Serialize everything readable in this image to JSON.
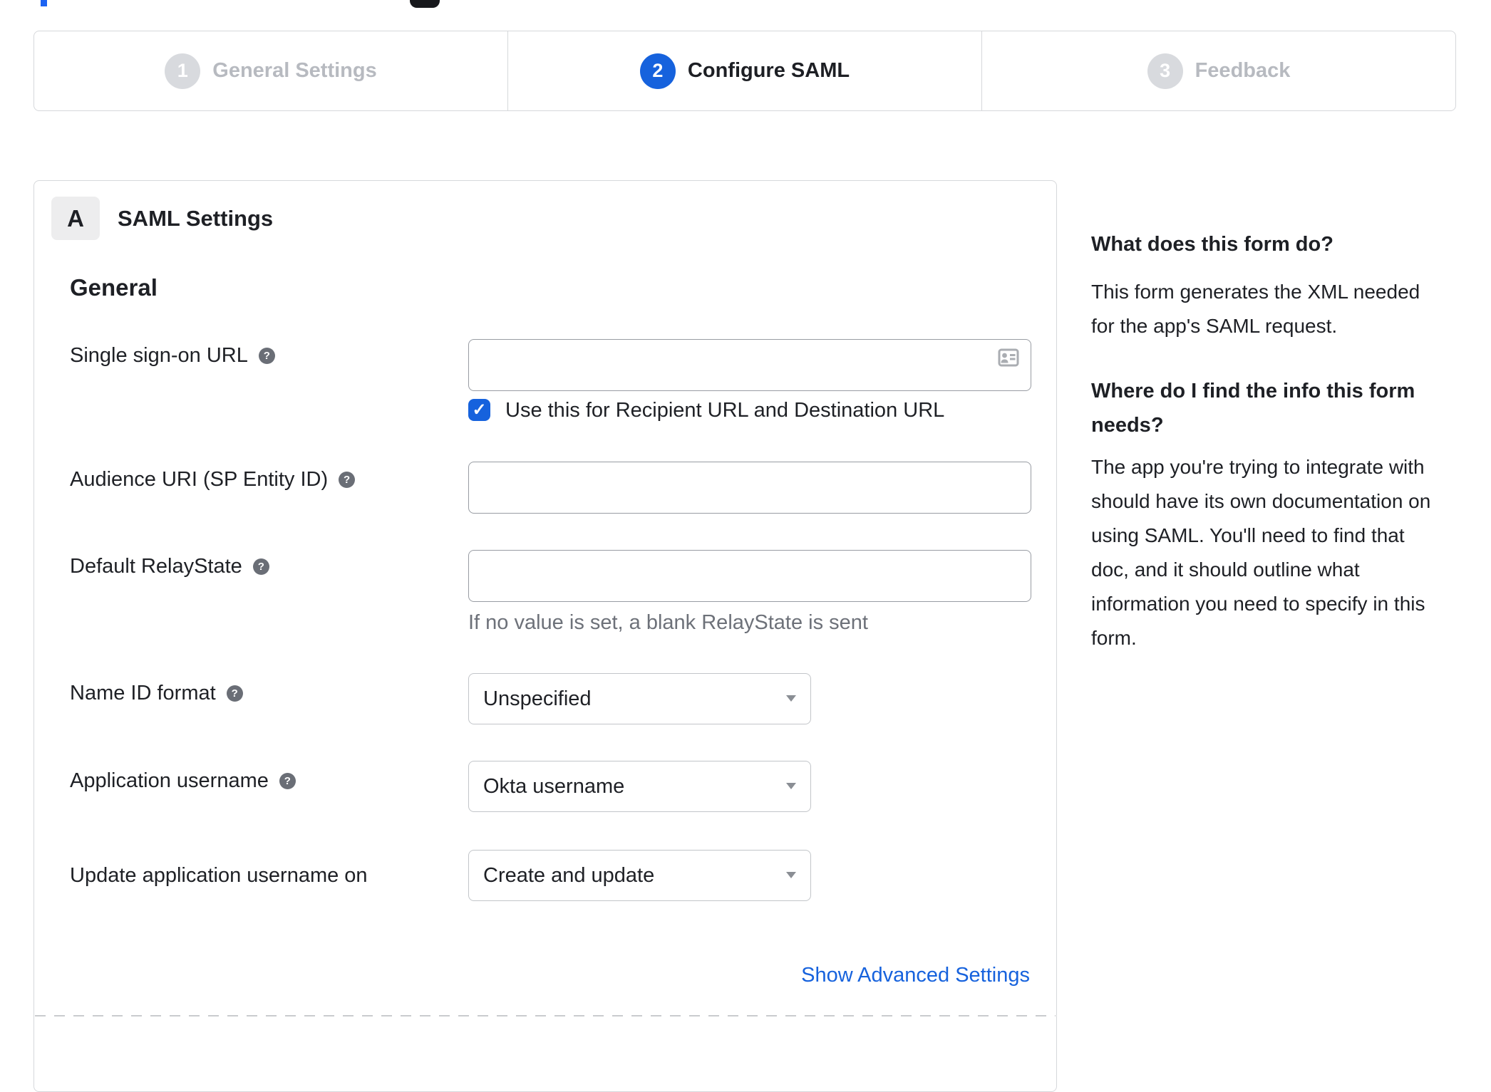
{
  "glyphs": {
    "help_icon": "?",
    "check_icon": "✓"
  },
  "stepper": {
    "steps": [
      {
        "number": "1",
        "label": "General Settings",
        "state": "inactive"
      },
      {
        "number": "2",
        "label": "Configure SAML",
        "state": "active"
      },
      {
        "number": "3",
        "label": "Feedback",
        "state": "inactive"
      }
    ]
  },
  "form": {
    "section_badge": "A",
    "section_title": "SAML Settings",
    "group_heading": "General",
    "sso_url": {
      "label": "Single sign-on URL",
      "value": "",
      "checkbox_label": "Use this for Recipient URL and Destination URL",
      "checkbox_checked": true
    },
    "audience_uri": {
      "label": "Audience URI (SP Entity ID)",
      "value": ""
    },
    "default_relay_state": {
      "label": "Default RelayState",
      "value": "",
      "hint": "If no value is set, a blank RelayState is sent"
    },
    "name_id_format": {
      "label": "Name ID format",
      "value": "Unspecified"
    },
    "application_username": {
      "label": "Application username",
      "value": "Okta username"
    },
    "update_application_username_on": {
      "label": "Update application username on",
      "value": "Create and update"
    },
    "advanced_link": "Show Advanced Settings"
  },
  "sidebar": {
    "heading_1": "What does this form do?",
    "paragraph_1": [
      "This form generates the XML needed",
      "for the app's SAML request."
    ],
    "heading_2": [
      "Where do I find the info this form",
      "needs?"
    ],
    "paragraph_2": [
      "The app you're trying to integrate with",
      "should have its own documentation on",
      "using SAML. You'll need to find that",
      "doc, and it should outline what",
      "information you need to specify in this",
      "form."
    ]
  },
  "colors": {
    "accent_blue": "#1662dd",
    "link_blue": "#1662dd",
    "inactive_gray": "#b7bac0",
    "border_gray": "#d6d8db",
    "input_border": "#94989e",
    "hint_gray": "#6d7179"
  }
}
